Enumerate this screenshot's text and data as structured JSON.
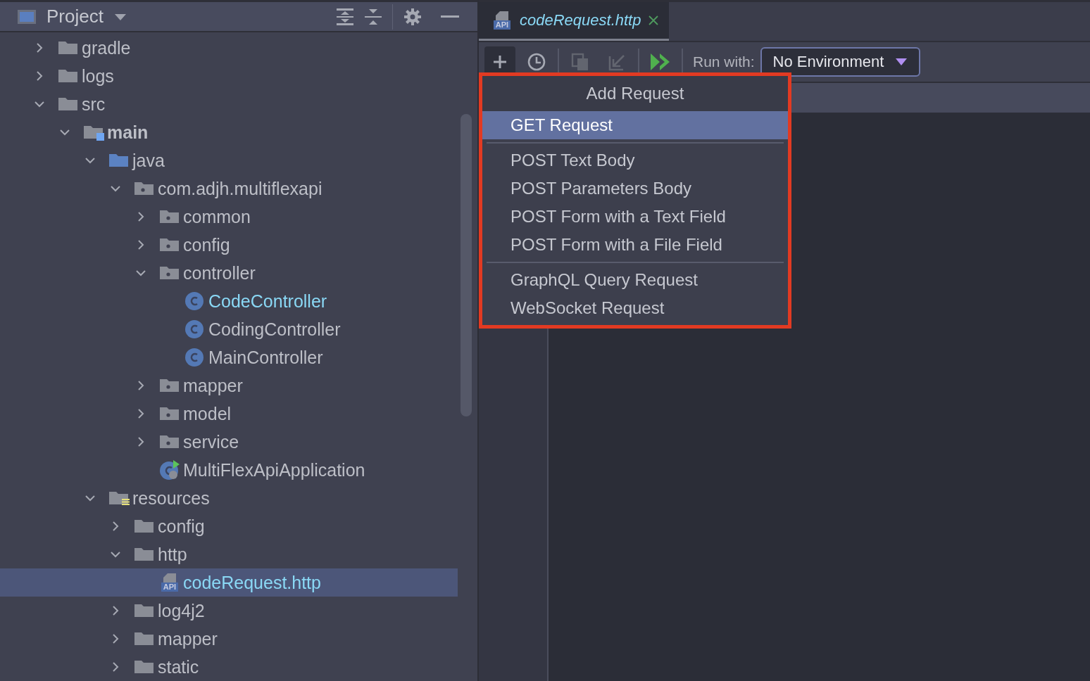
{
  "project_panel": {
    "title": "Project",
    "tree": [
      {
        "name": "gradle",
        "kind": "folder",
        "expanded": false,
        "selected": false,
        "changed": false
      },
      {
        "name": "logs",
        "kind": "folder",
        "expanded": false,
        "selected": false,
        "changed": false
      },
      {
        "name": "src",
        "kind": "folder",
        "expanded": true,
        "selected": false,
        "changed": false,
        "children": [
          {
            "name": "main",
            "kind": "source_root",
            "expanded": true,
            "selected": false,
            "changed": false,
            "children": [
              {
                "name": "java",
                "kind": "java_root",
                "expanded": true,
                "selected": false,
                "changed": false,
                "children": [
                  {
                    "name": "com.adjh.multiflexapi",
                    "kind": "package",
                    "expanded": true,
                    "selected": false,
                    "changed": false,
                    "children": [
                      {
                        "name": "common",
                        "kind": "package",
                        "expanded": false,
                        "selected": false,
                        "changed": false
                      },
                      {
                        "name": "config",
                        "kind": "package",
                        "expanded": false,
                        "selected": false,
                        "changed": false
                      },
                      {
                        "name": "controller",
                        "kind": "package",
                        "expanded": true,
                        "selected": false,
                        "changed": false,
                        "children": [
                          {
                            "name": "CodeController",
                            "kind": "class",
                            "selected": false,
                            "changed": true
                          },
                          {
                            "name": "CodingController",
                            "kind": "class",
                            "selected": false,
                            "changed": false
                          },
                          {
                            "name": "MainController",
                            "kind": "class",
                            "selected": false,
                            "changed": false
                          }
                        ]
                      },
                      {
                        "name": "mapper",
                        "kind": "package",
                        "expanded": false,
                        "selected": false,
                        "changed": false
                      },
                      {
                        "name": "model",
                        "kind": "package",
                        "expanded": false,
                        "selected": false,
                        "changed": false
                      },
                      {
                        "name": "service",
                        "kind": "package",
                        "expanded": false,
                        "selected": false,
                        "changed": false
                      },
                      {
                        "name": "MultiFlexApiApplication",
                        "kind": "app",
                        "selected": false,
                        "changed": false
                      }
                    ]
                  }
                ]
              },
              {
                "name": "resources",
                "kind": "resource_root",
                "expanded": true,
                "selected": false,
                "changed": false,
                "children": [
                  {
                    "name": "config",
                    "kind": "folder",
                    "expanded": false,
                    "selected": false,
                    "changed": false
                  },
                  {
                    "name": "http",
                    "kind": "folder",
                    "expanded": true,
                    "selected": false,
                    "changed": false,
                    "children": [
                      {
                        "name": "codeRequest.http",
                        "kind": "http",
                        "badge": "API",
                        "selected": true,
                        "changed": true
                      }
                    ]
                  },
                  {
                    "name": "log4j2",
                    "kind": "folder",
                    "expanded": false,
                    "selected": false,
                    "changed": false
                  },
                  {
                    "name": "mapper",
                    "kind": "folder",
                    "expanded": false,
                    "selected": false,
                    "changed": false
                  },
                  {
                    "name": "static",
                    "kind": "folder",
                    "expanded": false,
                    "selected": false,
                    "changed": false
                  }
                ]
              }
            ]
          }
        ]
      }
    ]
  },
  "editor": {
    "tabs": [
      {
        "label": "codeRequest.http",
        "badge": "API",
        "selected": true
      }
    ],
    "toolbar": [
      {
        "kind": "add",
        "active": true,
        "disabled": false
      },
      {
        "kind": "history",
        "active": false,
        "disabled": false
      },
      {
        "kind": "copy",
        "active": false,
        "disabled": true
      },
      {
        "kind": "import",
        "active": false,
        "disabled": true
      },
      {
        "kind": "run_all",
        "active": false,
        "disabled": false
      }
    ],
    "run_with_label": "Run with:",
    "environment": "No Environment"
  },
  "add_request_menu": {
    "title": "Add Request",
    "groups": [
      [
        {
          "label": "GET Request",
          "selected": true
        }
      ],
      [
        {
          "label": "POST Text Body",
          "selected": false
        },
        {
          "label": "POST Parameters Body",
          "selected": false
        },
        {
          "label": "POST Form with a Text Field",
          "selected": false
        },
        {
          "label": "POST Form with a File Field",
          "selected": false
        }
      ],
      [
        {
          "label": "GraphQL Query Request",
          "selected": false
        },
        {
          "label": "WebSocket Request",
          "selected": false
        }
      ]
    ]
  }
}
